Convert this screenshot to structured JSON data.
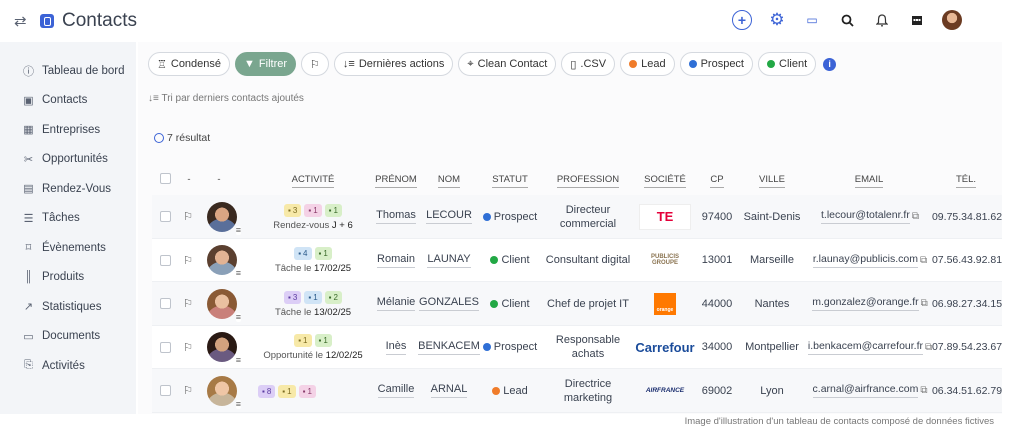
{
  "header": {
    "title": "Contacts",
    "icons": [
      "swap-icon",
      "contacts-icon",
      "add-icon",
      "settings-icon",
      "inbox-icon",
      "search-icon",
      "bell-icon",
      "calendar-icon",
      "user-avatar"
    ]
  },
  "sidebar": {
    "items": [
      {
        "label": "Tableau de bord",
        "icon": "dashboard-icon"
      },
      {
        "label": "Contacts",
        "icon": "contacts-icon"
      },
      {
        "label": "Entreprises",
        "icon": "buildings-icon"
      },
      {
        "label": "Opportunités",
        "icon": "opportunities-icon"
      },
      {
        "label": "Rendez-Vous",
        "icon": "calendar-icon"
      },
      {
        "label": "Tâches",
        "icon": "tasks-icon"
      },
      {
        "label": "Évènements",
        "icon": "bookmark-icon"
      },
      {
        "label": "Produits",
        "icon": "barcode-icon"
      },
      {
        "label": "Statistiques",
        "icon": "chart-icon"
      },
      {
        "label": "Documents",
        "icon": "folder-icon"
      },
      {
        "label": "Activités",
        "icon": "activity-icon"
      }
    ]
  },
  "toolbar": {
    "condensed": "Condensé",
    "filter": "Filtrer",
    "last_actions": "Dernières actions",
    "clean_contact": "Clean Contact",
    "csv": ".CSV",
    "lead": "Lead",
    "prospect": "Prospect",
    "client": "Client",
    "sort_text": "Tri par derniers contacts ajoutés",
    "results": "7 résultat"
  },
  "colors": {
    "accent": "#3c63d6",
    "filter_active": "#7aa68f",
    "lead": "#f07c2a",
    "prospect": "#2f6fd6",
    "client": "#22a845"
  },
  "table": {
    "headers": {
      "dash1": "-",
      "dash2": "-",
      "activite": "Activité",
      "prenom": "Prénom",
      "nom": "Nom",
      "statut": "Statut",
      "profession": "Profession",
      "societe": "Société",
      "cp": "CP",
      "ville": "Ville",
      "email": "Email",
      "tel": "Tél."
    },
    "rows": [
      {
        "badges": [
          {
            "cls": "y",
            "text": "3"
          },
          {
            "cls": "p",
            "text": "1"
          },
          {
            "cls": "g",
            "text": "1"
          }
        ],
        "activity_prefix": "Rendez-vous",
        "activity_date": "J + 6",
        "prenom": "Thomas",
        "nom": "LECOUR",
        "statut": "Prospect",
        "profession": "Directeur commercial",
        "logo": "te",
        "logo_text": "TE",
        "cp": "97400",
        "ville": "Saint-Denis",
        "email": "t.lecour@totalenr.fr",
        "tel": "09.75.34.81.62"
      },
      {
        "badges": [
          {
            "cls": "b",
            "text": "4"
          },
          {
            "cls": "g",
            "text": "1"
          }
        ],
        "activity_prefix": "Tâche le",
        "activity_date": "17/02/25",
        "prenom": "Romain",
        "nom": "LAUNAY",
        "statut": "Client",
        "profession": "Consultant digital",
        "logo": "pub",
        "logo_text": "PUBLICIS GROUPE",
        "cp": "13001",
        "ville": "Marseille",
        "email": "r.launay@publicis.com",
        "tel": "07.56.43.92.81"
      },
      {
        "badges": [
          {
            "cls": "v",
            "text": "3"
          },
          {
            "cls": "b",
            "text": "1"
          },
          {
            "cls": "g",
            "text": "2"
          }
        ],
        "activity_prefix": "Tâche le",
        "activity_date": "13/02/25",
        "prenom": "Mélanie",
        "nom": "GONZALES",
        "statut": "Client",
        "profession": "Chef de projet IT",
        "logo": "orange",
        "logo_text": "orange",
        "cp": "44000",
        "ville": "Nantes",
        "email": "m.gonzalez@orange.fr",
        "tel": "06.98.27.34.15"
      },
      {
        "badges": [
          {
            "cls": "y",
            "text": "1"
          },
          {
            "cls": "g",
            "text": "1"
          }
        ],
        "activity_prefix": "Opportunité le",
        "activity_date": "12/02/25",
        "prenom": "Inès",
        "nom": "BENKACEM",
        "statut": "Prospect",
        "profession": "Responsable achats",
        "logo": "carr",
        "logo_text": "Carrefour",
        "cp": "34000",
        "ville": "Montpellier",
        "email": "i.benkacem@carrefour.fr",
        "tel": "07.89.54.23.67"
      },
      {
        "badges": [
          {
            "cls": "v",
            "text": "8"
          },
          {
            "cls": "y",
            "text": "1"
          },
          {
            "cls": "p",
            "text": "1"
          }
        ],
        "activity_prefix": "",
        "activity_date": "",
        "prenom": "Camille",
        "nom": "ARNAL",
        "statut": "Lead",
        "profession": "Directrice marketing",
        "logo": "af",
        "logo_text": "AIRFRANCE",
        "cp": "69002",
        "ville": "Lyon",
        "email": "c.arnal@airfrance.com",
        "tel": "06.34.51.62.79"
      }
    ]
  },
  "caption": "Image d'illustration d'un tableau de contacts composé de données fictives"
}
